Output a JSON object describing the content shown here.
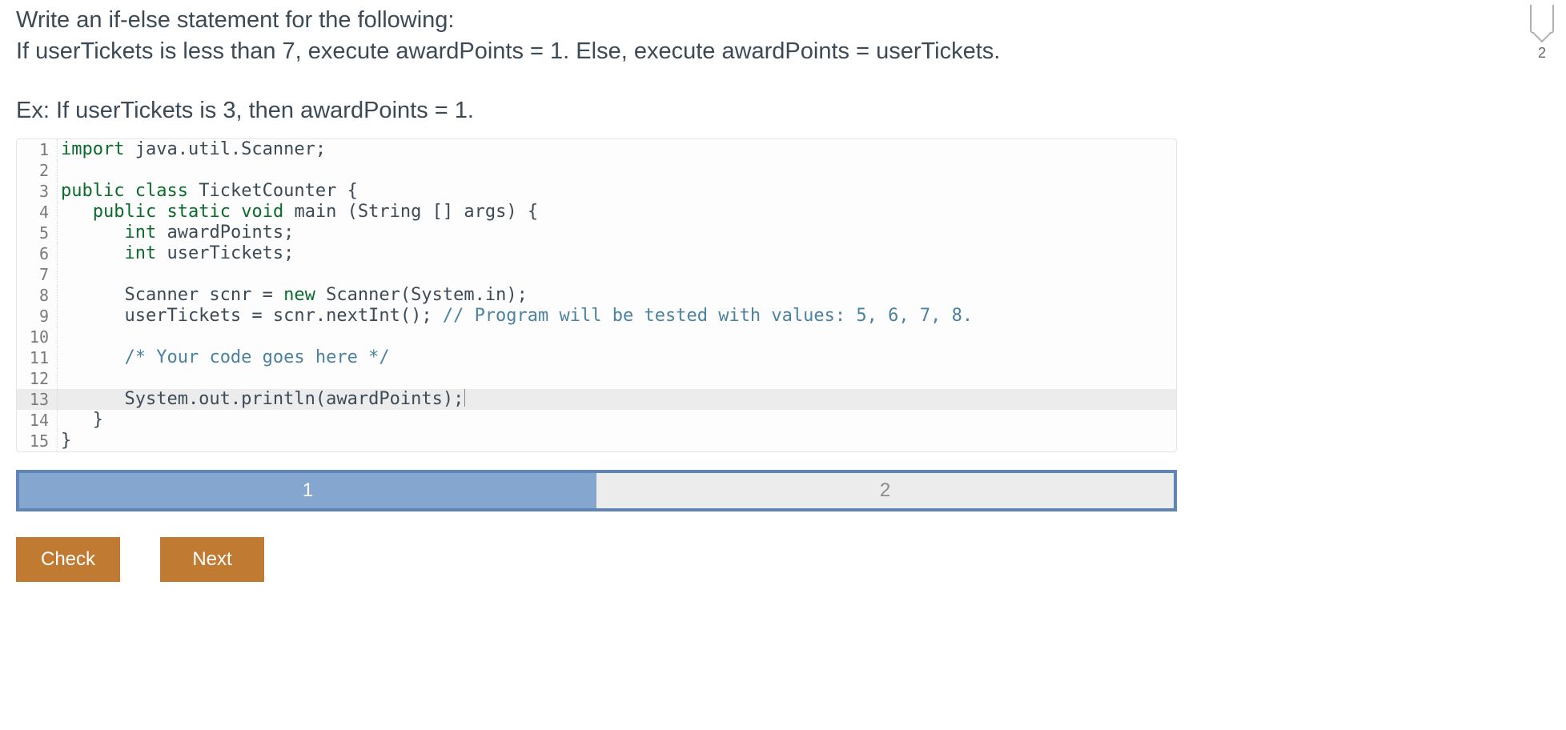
{
  "badge": {
    "count": "2"
  },
  "prompt": {
    "line1": "Write an if-else statement for the following:",
    "line2": "If userTickets is less than 7, execute awardPoints = 1. Else, execute awardPoints = userTickets."
  },
  "example": "Ex: If userTickets is 3, then awardPoints = 1.",
  "code": {
    "lines": [
      {
        "n": 1,
        "hl": false,
        "tokens": [
          [
            "kw",
            "import"
          ],
          [
            "",
            " java.util.Scanner;"
          ]
        ]
      },
      {
        "n": 2,
        "hl": false,
        "tokens": [
          [
            "",
            ""
          ]
        ]
      },
      {
        "n": 3,
        "hl": false,
        "tokens": [
          [
            "kw",
            "public"
          ],
          [
            "",
            " "
          ],
          [
            "kw",
            "class"
          ],
          [
            "",
            " TicketCounter {"
          ]
        ]
      },
      {
        "n": 4,
        "hl": false,
        "tokens": [
          [
            "",
            "   "
          ],
          [
            "kw",
            "public"
          ],
          [
            "",
            " "
          ],
          [
            "kw",
            "static"
          ],
          [
            "",
            " "
          ],
          [
            "kw",
            "void"
          ],
          [
            "",
            " main (String [] args) {"
          ]
        ]
      },
      {
        "n": 5,
        "hl": false,
        "tokens": [
          [
            "",
            "      "
          ],
          [
            "kw",
            "int"
          ],
          [
            "",
            " awardPoints;"
          ]
        ]
      },
      {
        "n": 6,
        "hl": false,
        "tokens": [
          [
            "",
            "      "
          ],
          [
            "kw",
            "int"
          ],
          [
            "",
            " userTickets;"
          ]
        ]
      },
      {
        "n": 7,
        "hl": false,
        "tokens": [
          [
            "",
            ""
          ]
        ]
      },
      {
        "n": 8,
        "hl": false,
        "tokens": [
          [
            "",
            "      Scanner scnr = "
          ],
          [
            "kw",
            "new"
          ],
          [
            "",
            " Scanner(System.in);"
          ]
        ]
      },
      {
        "n": 9,
        "hl": false,
        "tokens": [
          [
            "",
            "      userTickets = scnr.nextInt(); "
          ],
          [
            "cm",
            "// Program will be tested with values: 5, 6, 7, 8."
          ]
        ]
      },
      {
        "n": 10,
        "hl": false,
        "tokens": [
          [
            "",
            ""
          ]
        ]
      },
      {
        "n": 11,
        "hl": false,
        "tokens": [
          [
            "",
            "      "
          ],
          [
            "cm",
            "/* Your code goes here */"
          ]
        ]
      },
      {
        "n": 12,
        "hl": false,
        "tokens": [
          [
            "",
            ""
          ]
        ]
      },
      {
        "n": 13,
        "hl": true,
        "tokens": [
          [
            "",
            "      System.out.println(awardPoints);"
          ]
        ],
        "cursor": true
      },
      {
        "n": 14,
        "hl": false,
        "tokens": [
          [
            "",
            "   }"
          ]
        ]
      },
      {
        "n": 15,
        "hl": false,
        "tokens": [
          [
            "",
            "}"
          ]
        ]
      }
    ]
  },
  "tabs": [
    {
      "label": "1",
      "active": true
    },
    {
      "label": "2",
      "active": false
    }
  ],
  "buttons": {
    "check": "Check",
    "next": "Next"
  }
}
